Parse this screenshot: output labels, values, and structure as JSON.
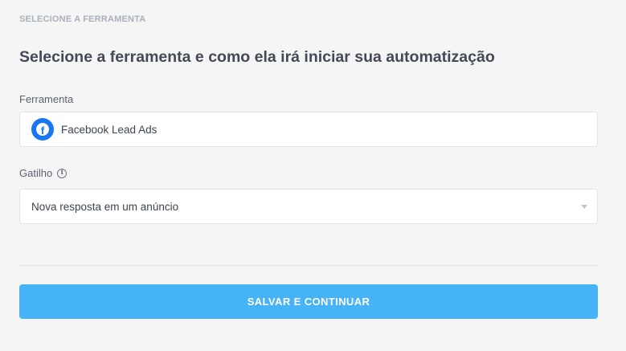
{
  "section_label": "SELECIONE A FERRAMENTA",
  "title": "Selecione a ferramenta e como ela irá iniciar sua automatização",
  "tool": {
    "label": "Ferramenta",
    "value": "Facebook Lead Ads",
    "icon": "facebook-icon",
    "icon_color": "#1877f2"
  },
  "trigger": {
    "label": "Gatilho",
    "info_icon": "info-icon",
    "selected": "Nova resposta em um anúncio"
  },
  "save_button": {
    "label": "SALVAR E CONTINUAR",
    "color": "#45b3f5"
  }
}
